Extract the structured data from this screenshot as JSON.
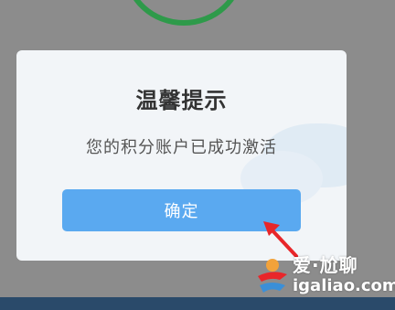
{
  "dialog": {
    "title": "温馨提示",
    "message": "您的积分账户已成功激活",
    "confirm_label": "确定"
  },
  "watermark": {
    "brand": "爱·尬聊",
    "url": "igaliao.com"
  },
  "colors": {
    "overlay": "#8c8c8c",
    "dialog_bg": "#f2f5f8",
    "button_bg": "#5aa9f0",
    "ring": "#2e9a4a",
    "arrow": "#e8262a",
    "bottom_bar": "#2a4a6a"
  },
  "icons": {
    "ring": "status-ring-icon",
    "arrow": "pointer-arrow-icon",
    "logo": "igaliao-logo-icon"
  }
}
